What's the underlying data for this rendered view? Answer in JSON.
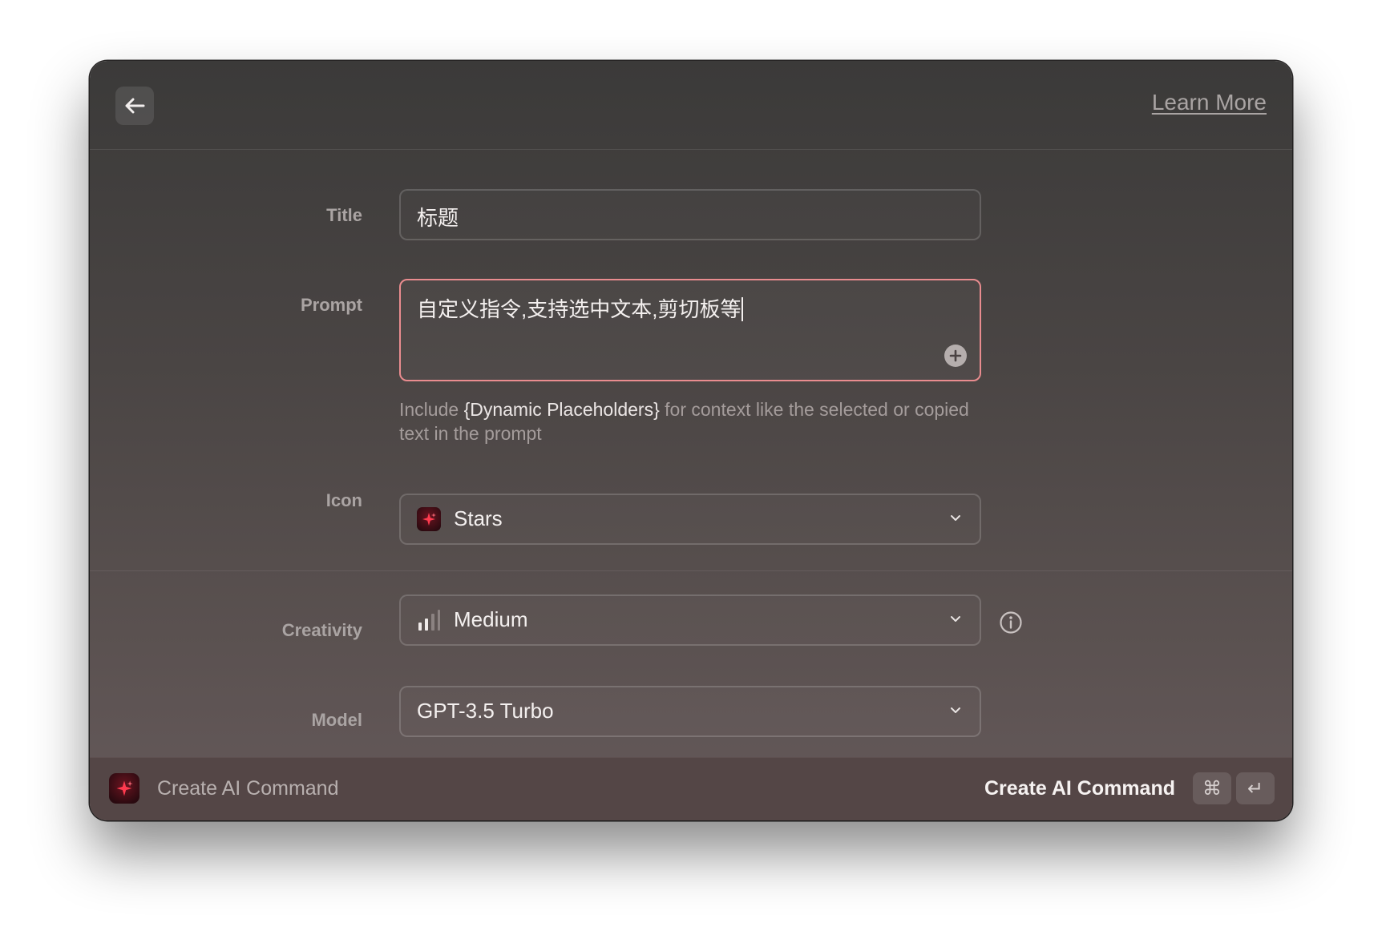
{
  "header": {
    "back_icon": "arrow-left-icon",
    "learn_more": "Learn More"
  },
  "form": {
    "title": {
      "label": "Title",
      "value": "标题"
    },
    "prompt": {
      "label": "Prompt",
      "value": "自定义指令,支持选中文本,剪切板等",
      "add_icon": "plus-circle-icon",
      "hint_prefix": "Include ",
      "hint_highlight": "{Dynamic Placeholders}",
      "hint_suffix": " for context like the selected or copied text in the prompt"
    },
    "icon": {
      "label": "Icon",
      "value": "Stars",
      "icon": "stars-icon"
    },
    "creativity": {
      "label": "Creativity",
      "value": "Medium",
      "icon": "signal-bars-icon",
      "info_icon": "info-icon"
    },
    "model": {
      "label": "Model",
      "value": "GPT-3.5 Turbo"
    }
  },
  "footer": {
    "title": "Create AI Command",
    "action": "Create AI Command",
    "shortcut_cmd": "⌘",
    "shortcut_enter": "↵"
  },
  "colors": {
    "accent_border": "#e98c8f",
    "star_red": "#ff3b4f"
  }
}
